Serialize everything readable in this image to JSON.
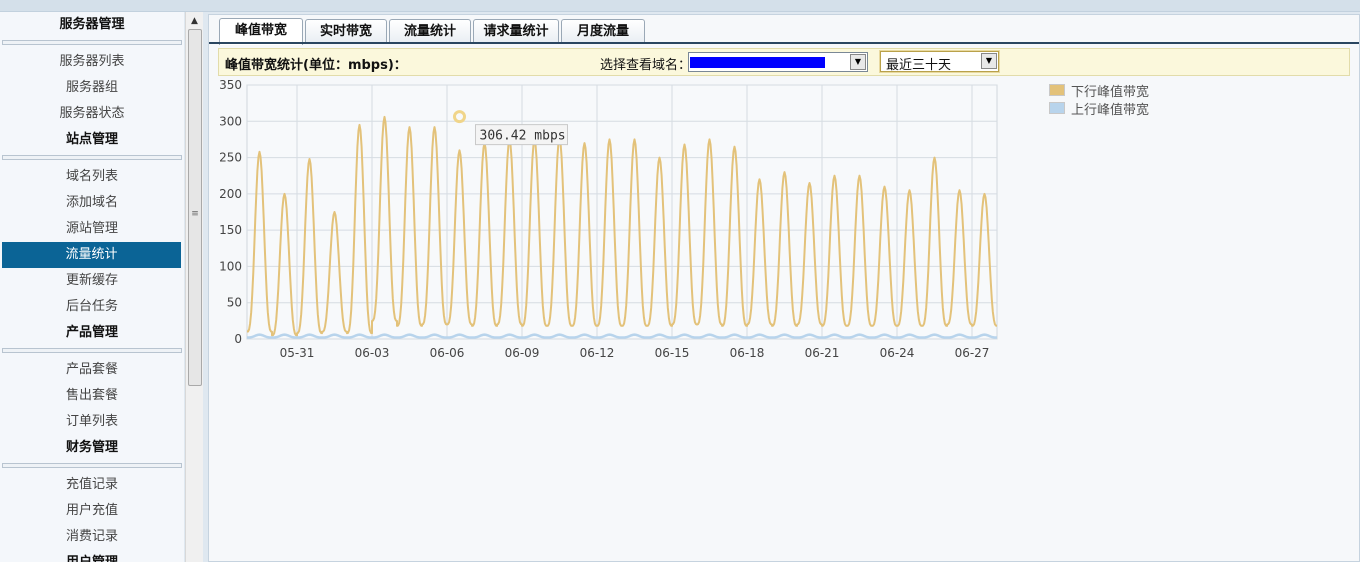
{
  "sidebar": {
    "groups": [
      {
        "title": "服务器管理",
        "items": [
          "服务器列表",
          "服务器组",
          "服务器状态"
        ]
      },
      {
        "title": "站点管理",
        "items": [
          "域名列表",
          "添加域名",
          "源站管理",
          "流量统计",
          "更新缓存",
          "后台任务"
        ]
      },
      {
        "title": "产品管理",
        "items": [
          "产品套餐",
          "售出套餐",
          "订单列表"
        ]
      },
      {
        "title": "财务管理",
        "items": [
          "充值记录",
          "用户充值",
          "消费记录"
        ]
      },
      {
        "title": "用户管理",
        "items": []
      }
    ],
    "active_item": "流量统计"
  },
  "tabs": [
    "峰值带宽",
    "实时带宽",
    "流量统计",
    "请求量统计",
    "月度流量"
  ],
  "active_tab": "峰值带宽",
  "filter": {
    "title": "峰值带宽统计(单位：mbps)：",
    "domain_label": "选择查看域名：",
    "range_value": "最近三十天"
  },
  "colors": {
    "down": "#e3c27a",
    "up": "#b8d4ec",
    "active_nav": "#0b6496",
    "tab_rule": "#2a4660"
  },
  "chart_data": {
    "type": "line",
    "title": "",
    "unit": "mbps",
    "ylim": [
      0,
      350
    ],
    "yticks": [
      0,
      50,
      100,
      150,
      200,
      250,
      300,
      350
    ],
    "xlim": [
      "05-29",
      "06-28"
    ],
    "xticks": [
      "05-31",
      "06-03",
      "06-06",
      "06-09",
      "06-12",
      "06-15",
      "06-18",
      "06-21",
      "06-24",
      "06-27"
    ],
    "grid": true,
    "legend_position": "right",
    "tooltip": {
      "date": "06-07",
      "value": 306.42,
      "text": "306.42 mbps"
    },
    "series": [
      {
        "name": "下行峰值带宽",
        "color": "#e3c27a",
        "daily_troughs": [
          10,
          5,
          8,
          10,
          8,
          25,
          18,
          20,
          20,
          18,
          20,
          18,
          18,
          18,
          18,
          18,
          18,
          20,
          20,
          18,
          20,
          18,
          20,
          18,
          18,
          18,
          18,
          18,
          20,
          18
        ],
        "daily_peaks": [
          258,
          200,
          248,
          175,
          295,
          306,
          292,
          292,
          260,
          270,
          275,
          275,
          278,
          270,
          275,
          275,
          250,
          268,
          275,
          265,
          220,
          230,
          215,
          225,
          225,
          210,
          205,
          250,
          205,
          200
        ]
      },
      {
        "name": "上行峰值带宽",
        "color": "#b8d4ec",
        "daily_troughs": [
          2,
          2,
          2,
          2,
          2,
          2,
          2,
          2,
          2,
          2,
          2,
          2,
          2,
          2,
          2,
          2,
          2,
          2,
          2,
          2,
          2,
          2,
          2,
          2,
          2,
          2,
          2,
          2,
          2,
          2
        ],
        "daily_peaks": [
          6,
          6,
          6,
          6,
          6,
          6,
          6,
          6,
          6,
          6,
          6,
          6,
          6,
          6,
          6,
          6,
          6,
          6,
          6,
          6,
          6,
          6,
          6,
          6,
          6,
          6,
          6,
          6,
          6,
          6
        ]
      }
    ]
  }
}
